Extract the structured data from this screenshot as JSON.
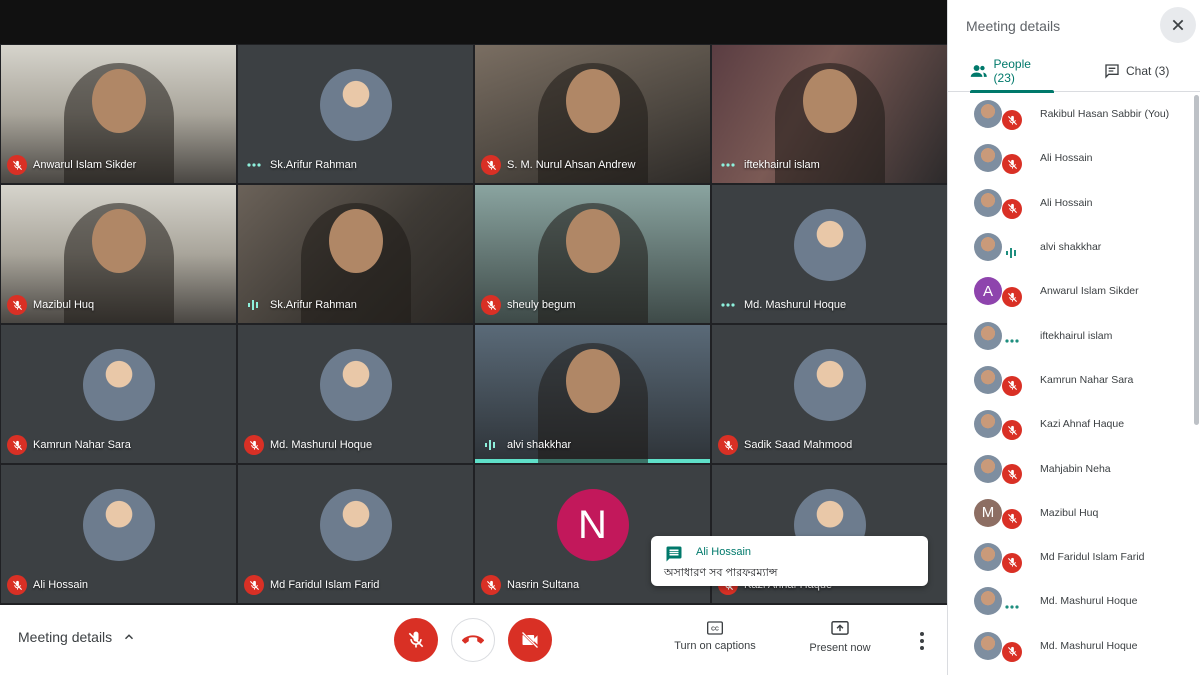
{
  "tiles": [
    {
      "name": "Anwarul Islam Sikder",
      "status": "muted",
      "kind": "video",
      "variant": "v4"
    },
    {
      "name": "Sk.Arifur Rahman",
      "status": "dots",
      "kind": "avatar"
    },
    {
      "name": "S. M. Nurul Ahsan Andrew",
      "status": "muted",
      "kind": "video",
      "variant": "v2"
    },
    {
      "name": "iftekhairul islam",
      "status": "dots",
      "kind": "video",
      "variant": "v3"
    },
    {
      "name": "Mazibul Huq",
      "status": "muted",
      "kind": "video",
      "variant": "v4"
    },
    {
      "name": "Sk.Arifur Rahman",
      "status": "talking",
      "kind": "video",
      "variant": "v1"
    },
    {
      "name": "sheuly begum",
      "status": "muted",
      "kind": "video",
      "variant": "v5"
    },
    {
      "name": "Md. Mashurul Hoque",
      "status": "dots",
      "kind": "avatar"
    },
    {
      "name": "Kamrun Nahar Sara",
      "status": "muted",
      "kind": "avatar"
    },
    {
      "name": "Md. Mashurul Hoque",
      "status": "muted",
      "kind": "avatar"
    },
    {
      "name": "alvi shakkhar",
      "status": "talking",
      "kind": "video",
      "variant": "v6",
      "active": true
    },
    {
      "name": "Sadik Saad Mahmood",
      "status": "muted",
      "kind": "avatar"
    },
    {
      "name": "Ali Hossain",
      "status": "muted",
      "kind": "avatar"
    },
    {
      "name": "Md Faridul Islam Farid",
      "status": "muted",
      "kind": "avatar"
    },
    {
      "name": "Nasrin Sultana",
      "status": "muted",
      "kind": "letter",
      "letter": "N"
    },
    {
      "name": "Kazi Ahnaf Haque",
      "status": "muted",
      "kind": "avatar"
    }
  ],
  "bottom_bar": {
    "meeting_details_label": "Meeting details",
    "captions_label": "Turn on captions",
    "present_label": "Present now"
  },
  "panel": {
    "title": "Meeting details",
    "people_tab": "People (23)",
    "chat_tab": "Chat (3)",
    "people": [
      {
        "name": "Rakibul Hasan Sabbir (You)",
        "status": "muted"
      },
      {
        "name": "Ali Hossain",
        "status": "muted"
      },
      {
        "name": "Ali Hossain",
        "status": "muted"
      },
      {
        "name": "alvi shakkhar",
        "status": "talking"
      },
      {
        "name": "Anwarul Islam Sikder",
        "status": "muted",
        "letter": "A",
        "color": "#8e44ad"
      },
      {
        "name": "iftekhairul islam",
        "status": "dots"
      },
      {
        "name": "Kamrun Nahar Sara",
        "status": "muted"
      },
      {
        "name": "Kazi Ahnaf Haque",
        "status": "muted"
      },
      {
        "name": "Mahjabin Neha",
        "status": "muted"
      },
      {
        "name": "Mazibul Huq",
        "status": "muted",
        "letter": "M",
        "color": "#8d6e63"
      },
      {
        "name": "Md Faridul Islam Farid",
        "status": "muted"
      },
      {
        "name": "Md. Mashurul Hoque",
        "status": "dots"
      },
      {
        "name": "Md. Mashurul Hoque",
        "status": "muted"
      }
    ]
  },
  "toast": {
    "sender": "Ali Hossain",
    "message": "অসাধারণ সব পারফরম্যান্স"
  },
  "colors": {
    "accent": "#00796b",
    "muted_red": "#d93025",
    "speaking_teal": "#5fe0c9",
    "letter_n": "#c2185b"
  }
}
